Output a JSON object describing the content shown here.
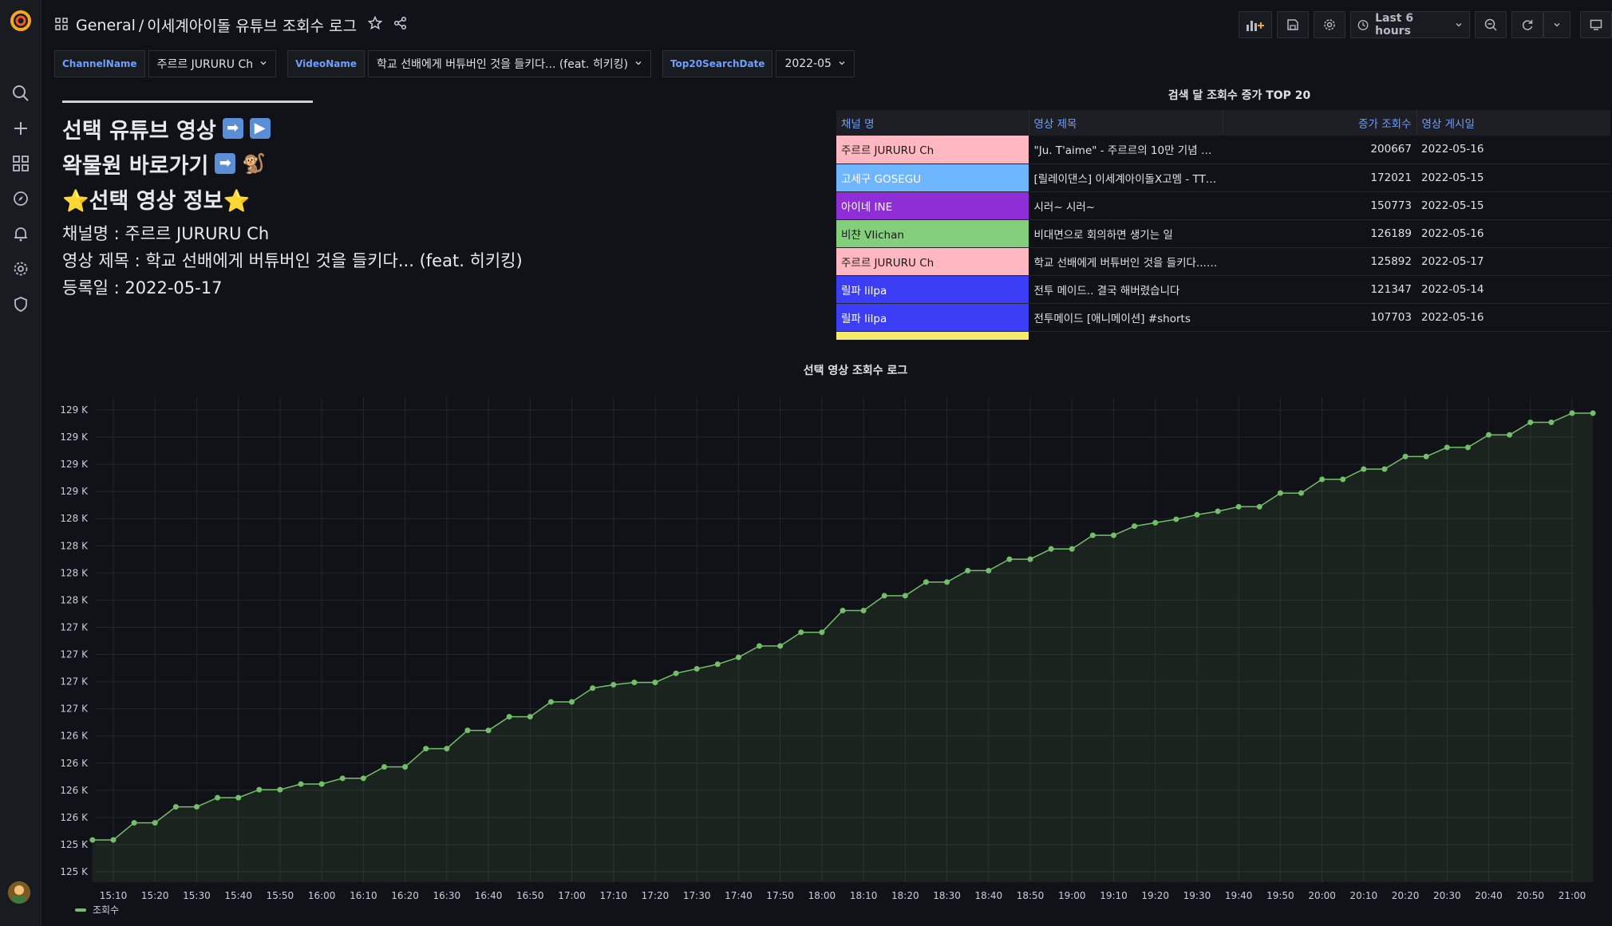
{
  "app": {
    "breadcrumb_folder": "General",
    "breadcrumb_sep": "/",
    "dashboard_title": "이세계아이돌 유튜브 조회수 로그"
  },
  "toolbar": {
    "time_range": "Last 6 hours"
  },
  "variables": [
    {
      "label": "ChannelName",
      "value": "주르르 JURURU Ch"
    },
    {
      "label": "VideoName",
      "value": "학교 선배에게 버튜버인 것을 들키다... (feat. 히키킹)"
    },
    {
      "label": "Top20SearchDate",
      "value": "2022-05"
    }
  ],
  "text_panel": {
    "divider": "",
    "link_video": "선택 유튜브 영상",
    "link_waktaverse": "왁물원 바로가기",
    "info_title": "⭐선택 영상 정보⭐",
    "channel_line": "채널명 : 주르르 JURURU Ch",
    "title_line": "영상 제목 : 학교 선배에게 버튜버인 것을 들키다... (feat. 히키킹)",
    "date_line": "등록일 : 2022-05-17"
  },
  "top20": {
    "title": "검색 달 조회수 증가 TOP 20",
    "columns": [
      "채널 명",
      "영상 제목",
      "증가 조회수",
      "영상 게시일"
    ],
    "rows": [
      {
        "channel": "주르르 JURURU Ch",
        "title": "\"Ju. T'aime\" - 주르르의 10만 기념 언...",
        "views": "200667",
        "date": "2022-05-16",
        "color": "#ffb8c1",
        "text_color": "#1a1a1a"
      },
      {
        "channel": "고세구 GOSEGU",
        "title": "[릴레이댄스] 이세계아이돌X고멤 - TT (...",
        "views": "172021",
        "date": "2022-05-15",
        "color": "#6eb6ff",
        "text_color": "#ffffff"
      },
      {
        "channel": "아이네 INE",
        "title": "시러~ 시러~",
        "views": "150773",
        "date": "2022-05-15",
        "color": "#8f2ed6",
        "text_color": "#ffffff"
      },
      {
        "channel": "비챤 VIichan",
        "title": "비대면으로 회의하면 생기는 일",
        "views": "126189",
        "date": "2022-05-16",
        "color": "#84cf7b",
        "text_color": "#1a1a1a"
      },
      {
        "channel": "주르르 JURURU Ch",
        "title": "학교 선배에게 버튜버인 것을 들키다... (...",
        "views": "125892",
        "date": "2022-05-17",
        "color": "#ffb8c1",
        "text_color": "#1a1a1a"
      },
      {
        "channel": "릴파 lilpa",
        "title": "전투 메이드.. 결국 해버렸습니다",
        "views": "121347",
        "date": "2022-05-14",
        "color": "#3b3ef5",
        "text_color": "#ffffff"
      },
      {
        "channel": "릴파 lilpa",
        "title": "전투메이드 [애니메이션] #shorts",
        "views": "107703",
        "date": "2022-05-16",
        "color": "#3b3ef5",
        "text_color": "#ffffff"
      },
      {
        "channel": "",
        "title": "",
        "views": "",
        "date": "",
        "color": "#f5e96a",
        "text_color": "#1a1a1a"
      }
    ]
  },
  "chart_data": {
    "type": "area",
    "title": "선택 영상 조회수 로그",
    "series": [
      {
        "name": "조회수",
        "color": "#73bf69"
      }
    ],
    "y_tick_labels": [
      "125 K",
      "125 K",
      "126 K",
      "126 K",
      "126 K",
      "126 K",
      "127 K",
      "127 K",
      "127 K",
      "127 K",
      "128 K",
      "128 K",
      "128 K",
      "128 K",
      "129 K",
      "129 K",
      "129 K",
      "129 K"
    ],
    "x_tick_labels": [
      "15:10",
      "15:20",
      "15:30",
      "15:40",
      "15:50",
      "16:00",
      "16:10",
      "16:20",
      "16:30",
      "16:40",
      "16:50",
      "17:00",
      "17:10",
      "17:20",
      "17:30",
      "17:40",
      "17:50",
      "18:00",
      "18:10",
      "18:20",
      "18:30",
      "18:40",
      "18:50",
      "19:00",
      "19:10",
      "19:20",
      "19:30",
      "19:40",
      "19:50",
      "20:00",
      "20:10",
      "20:20",
      "20:30",
      "20:40",
      "20:50",
      "21:00"
    ],
    "ylim": [
      124950,
      129200
    ],
    "x_start": "15:10",
    "x_step_minutes": 5,
    "values": [
      125320,
      125320,
      125470,
      125470,
      125610,
      125610,
      125690,
      125690,
      125760,
      125760,
      125810,
      125810,
      125860,
      125860,
      125960,
      125960,
      126120,
      126120,
      126280,
      126280,
      126400,
      126400,
      126530,
      126530,
      126650,
      126680,
      126700,
      126700,
      126780,
      126820,
      126860,
      126920,
      127020,
      127020,
      127140,
      127140,
      127330,
      127330,
      127460,
      127460,
      127580,
      127580,
      127680,
      127680,
      127780,
      127780,
      127870,
      127870,
      127990,
      127990,
      128070,
      128100,
      128130,
      128170,
      128200,
      128240,
      128240,
      128360,
      128360,
      128480,
      128480,
      128570,
      128570,
      128680,
      128680,
      128760,
      128760,
      128870,
      128870,
      128980,
      128980,
      129060,
      129060
    ]
  }
}
